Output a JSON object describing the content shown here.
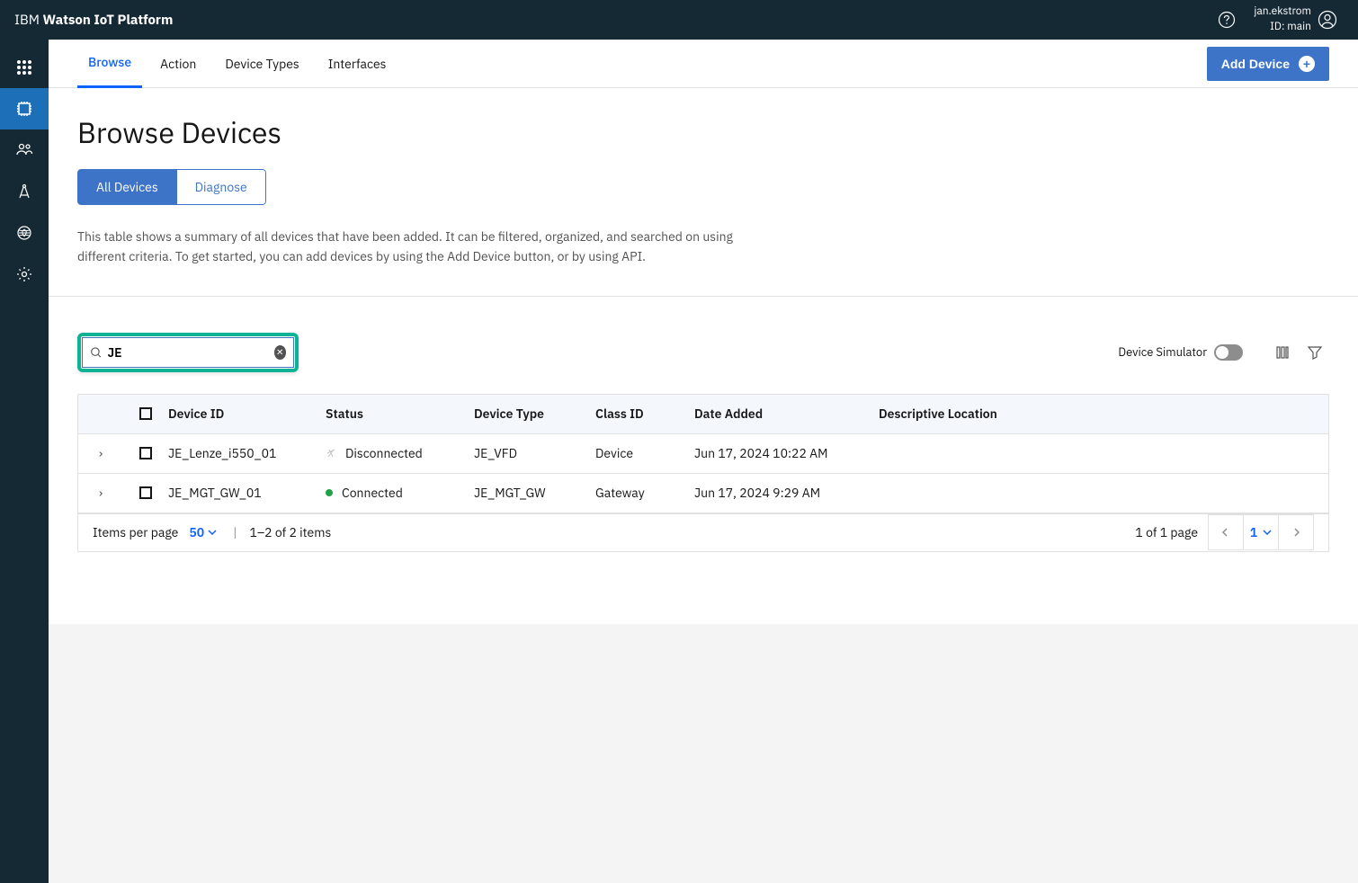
{
  "header": {
    "title_prefix": "IBM ",
    "title_bold": "Watson IoT Platform",
    "username": "jan.ekstrom",
    "id_label": "ID: main"
  },
  "tabs": {
    "items": [
      "Browse",
      "Action",
      "Device Types",
      "Interfaces"
    ],
    "add_button": "Add Device"
  },
  "page": {
    "title": "Browse Devices",
    "pills": [
      "All Devices",
      "Diagnose"
    ],
    "description": "This table shows a summary of all devices that have been added. It can be filtered, organized, and searched on using different criteria. To get started, you can add devices by using the Add Device button, or by using API."
  },
  "toolbar": {
    "search_value": "JE",
    "simulator_label": "Device Simulator"
  },
  "table": {
    "headers": {
      "device_id": "Device ID",
      "status": "Status",
      "device_type": "Device Type",
      "class_id": "Class ID",
      "date_added": "Date Added",
      "location": "Descriptive Location"
    },
    "rows": [
      {
        "device_id": "JE_Lenze_i550_01",
        "status": "Disconnected",
        "connected": false,
        "device_type": "JE_VFD",
        "class_id": "Device",
        "date_added": "Jun 17, 2024 10:22 AM",
        "location": ""
      },
      {
        "device_id": "JE_MGT_GW_01",
        "status": "Connected",
        "connected": true,
        "device_type": "JE_MGT_GW",
        "class_id": "Gateway",
        "date_added": "Jun 17, 2024 9:29 AM",
        "location": ""
      }
    ],
    "footer": {
      "items_per_page_label": "Items per page",
      "items_per_page_value": "50",
      "range": "1–2 of 2 items",
      "page_info": "1 of 1 page",
      "current_page": "1"
    }
  }
}
